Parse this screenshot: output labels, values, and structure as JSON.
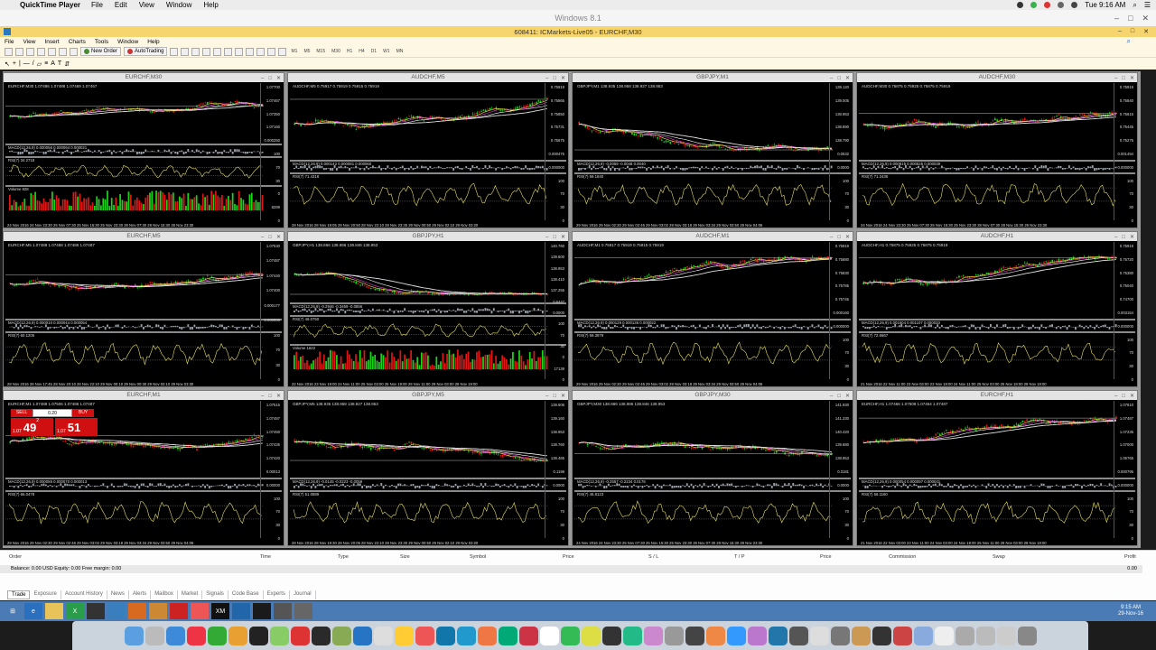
{
  "mac_menubar": {
    "app_name": "QuickTime Player",
    "menus": [
      "File",
      "Edit",
      "View",
      "Window",
      "Help"
    ],
    "clock": "Tue 9:16 AM"
  },
  "vm_title": "Windows 8.1",
  "mt4": {
    "title": "608411: ICMarkets-Live05 - EURCHF,M30",
    "menus": [
      "File",
      "View",
      "Insert",
      "Charts",
      "Tools",
      "Window",
      "Help"
    ],
    "new_order": "New Order",
    "autotrading": "AutoTrading",
    "timeframes": [
      "M1",
      "M5",
      "M15",
      "M30",
      "H1",
      "H4",
      "D1",
      "W1",
      "MN"
    ]
  },
  "charts": [
    {
      "title": "EURCHF,M30",
      "header": "EURCHF,M30 1.07486 1.07488 1.07469 1.07467",
      "macd": "MACD(12,26,9) 0.000056 0.000094 0.000021",
      "rsi": "RSI(7) 34.2718",
      "volume": "Volume 828",
      "xlabels": "24 Nov 2016   24 Nov 23:30   25 Nov 07:30   25 Nov 15:30   25 Nov 23:30   28 Nov 07:30   28 Nov 15:30   28 Nov 23:30",
      "scale": [
        "1.07700",
        "1.07467",
        "1.07350",
        "1.07160",
        "0.000250",
        "100",
        "70",
        "30",
        "0",
        "8289",
        "0"
      ]
    },
    {
      "title": "AUDCHF,M5",
      "header": "AUDCHF,M5 0.75917 0.75919 0.75915 0.75919",
      "macd": "MACD(12,26,9) 0.000142 0.000081 0.000060",
      "rsi": "RSI(7) 71.4318",
      "volume": "",
      "xlabels": "28 Nov 2016   28 Nov 19:05   28 Nov 20:50   28 Nov 22:10   28 Nov 23:35   29 Nov 00:50   29 Nov 02:10   29 Nov 03:20",
      "scale": [
        "0.75919",
        "0.75865",
        "0.75850",
        "0.75731",
        "0.75675",
        "0.000475",
        "0.000000",
        "100",
        "70",
        "30",
        "0"
      ]
    },
    {
      "title": "GBPJPY,M1",
      "header": "GBPJPY,M1 138.935 138.958 138.927 138.953",
      "macd": "MACD(12,26,9) -0.0059 -0.0048 0.0040",
      "rsi": "RSI(7) 59.1840",
      "volume": "",
      "xlabels": "29 Nov 2016   29 Nov 02:30   29 Nov 02:46   29 Nov 03:02   29 Nov 03:18   29 Nov 03:34   29 Nov 03:50   29 Nov 04:06",
      "scale": [
        "139.120",
        "139.005",
        "138.953",
        "138.890",
        "138.790",
        "0.0532",
        "0.0000",
        "100",
        "70",
        "30",
        "0"
      ]
    },
    {
      "title": "AUDCHF,M30",
      "header": "AUDCHF,M30 0.75875 0.75925 0.75875 0.75919",
      "macd": "MACD(12,26,9) 0.000915 0.000525 0.000039",
      "rsi": "RSI(7) 71.2436",
      "volume": "",
      "xlabels": "24 Nov 2016   24 Nov 23:30   25 Nov 07:30   25 Nov 15:30   25 Nov 23:30   28 Nov 07:30   28 Nov 15:30   28 Nov 23:30",
      "scale": [
        "0.75919",
        "0.75840",
        "0.75615",
        "0.75445",
        "0.75275",
        "0.001494",
        "0.000000",
        "100",
        "70",
        "30",
        "0"
      ]
    },
    {
      "title": "EURCHF,M5",
      "header": "EURCHF,M5 1.07488 1.07488 1.07486 1.07487",
      "macd": "MACD(12,26,9) 0.000010 0.000044 0.000054",
      "rsi": "RSI(7) 60.1206",
      "volume": "",
      "xlabels": "28 Nov 2016   28 Nov 17:45   28 Nov 20:10   28 Nov 22:10   29 Nov 00:10   29 Nov 00:30   29 Nov 02:10   29 Nov 03:30",
      "scale": [
        "1.07530",
        "1.07487",
        "1.07440",
        "1.07400",
        "0.000177",
        "0.000000",
        "100",
        "70",
        "30",
        "0"
      ]
    },
    {
      "title": "GBPJPY,H1",
      "header": "GBPJPY,H1 138.866 138.986 138.846 138.953",
      "macd": "MACD(12,26,9) -0.2946 -0.3459 -0.0856",
      "rsi": "RSI(7) 46.0750",
      "volume": "Volume 1622",
      "xlabels": "22 Nov 2016   23 Nov 19:00   24 Nov 11:00   25 Nov 03:00   25 Nov 19:00   28 Nov 11:00   29 Nov 03:00   28 Nov 19:00",
      "scale": [
        "140.760",
        "139.600",
        "138.953",
        "138.410",
        "137.255",
        "0.6447",
        "0.0000",
        "100",
        "70",
        "30",
        "0",
        "17139",
        "0"
      ]
    },
    {
      "title": "AUDCHF,M1",
      "header": "AUDCHF,M1 0.75917 0.75919 0.75915 0.75919",
      "macd": "MACD(12,26,9) 0.000129 0.000136 0.000022",
      "rsi": "RSI(7) 69.3879",
      "volume": "",
      "xlabels": "29 Nov 2016   29 Nov 02:30   29 Nov 02:46   29 Nov 03:02   29 Nov 03:18   29 Nov 03:34   29 Nov 03:50   29 Nov 04:06",
      "scale": [
        "0.75919",
        "0.75880",
        "0.75830",
        "0.75785",
        "0.75745",
        "0.000160",
        "0.000000",
        "100",
        "70",
        "30",
        "0"
      ]
    },
    {
      "title": "AUDCHF,H1",
      "header": "AUDCHF,H1 0.75875 0.75925 0.75875 0.75919",
      "macd": "MACD(12,26,9) 0.001604 0.001107 0.000033",
      "rsi": "RSI(7) 72.6667",
      "volume": "",
      "xlabels": "21 Nov 2016   22 Nov 11:00   23 Nov 03:00   23 Nov 19:00   24 Nov 11:00   25 Nov 03:00   25 Nov 19:00   28 Nov 19:00",
      "scale": [
        "0.75919",
        "0.75720",
        "0.75380",
        "0.75040",
        "0.74700",
        "0.003154",
        "0.000000",
        "100",
        "70",
        "30",
        "0"
      ]
    },
    {
      "title": "EURCHF,M1",
      "header": "EURCHF,M1 1.07488 1.07506 1.07486 1.07487",
      "macd": "MACD(12,26,9) 0.000085 0.000070 0.000013",
      "rsi": "RSI(7) 66.0478",
      "volume": "",
      "xlabels": "29 Nov 2016   29 Nov 02:30   29 Nov 02:46   29 Nov 03:02   29 Nov 03:18   29 Nov 03:34   29 Nov 03:50   29 Nov 04:06",
      "scale": [
        "1.07515",
        "1.07487",
        "1.07450",
        "1.07435",
        "1.07420",
        "0.00013",
        "0.00000",
        "100",
        "70",
        "30",
        "0"
      ]
    },
    {
      "title": "GBPJPY,M5",
      "header": "GBPJPY,M5 138.935 138.958 138.927 138.953",
      "macd": "MACD(12,26,9) -0.0145 -0.0223 -0.0058",
      "rsi": "RSI(7) 51.0889",
      "volume": "",
      "xlabels": "28 Nov 2016   28 Nov 19:30   28 Nov 20:05   28 Nov 22:10   28 Nov 23:30   29 Nov 00:50   29 Nov 02:10   29 Nov 03:20",
      "scale": [
        "139.606",
        "139.160",
        "138.953",
        "138.760",
        "138.465",
        "0.1198",
        "0.0000",
        "100",
        "70",
        "30",
        "0"
      ]
    },
    {
      "title": "GBPJPY,M30",
      "header": "GBPJPY,M30 138.886 138.986 138.846 138.953",
      "macd": "MACD(12,26,9) -0.2557 -0.2234 0.0176",
      "rsi": "RSI(7) 46.8123",
      "volume": "",
      "xlabels": "24 Nov 2016   24 Nov 23:30   25 Nov 07:30   25 Nov 15:30   25 Nov 23:30   28 Nov 07:30   28 Nov 15:30   28 Nov 23:30",
      "scale": [
        "141.930",
        "141.230",
        "140.420",
        "139.680",
        "138.953",
        "0.3181",
        "0.0000",
        "100",
        "70",
        "30",
        "0"
      ]
    },
    {
      "title": "EURCHF,H1",
      "header": "EURCHF,H1 1.07466 1.07508 1.07464 1.07487",
      "macd": "MACD(12,26,9) 0.000054 0.000097 0.000041",
      "rsi": "RSI(7) 56.1160",
      "volume": "",
      "xlabels": "21 Nov 2016   22 Nov 03:00   23 Nov 11:00   24 Nov 03:00   24 Nov 19:00   25 Nov 11:00   28 Nov 03:00   28 Nov 19:00",
      "scale": [
        "1.07810",
        "1.07487",
        "1.07235",
        "1.07000",
        "1.06765",
        "0.000795",
        "0.000000",
        "100",
        "70",
        "30",
        "0"
      ]
    }
  ],
  "oneclick": {
    "sell": "SELL",
    "buy": "BUY",
    "lot": "0.20",
    "sell_small": "1.07",
    "sell_big": "49",
    "sell_sup": "2",
    "buy_small": "1.07",
    "buy_big": "51"
  },
  "terminal": {
    "columns": [
      "Order",
      "Time",
      "Type",
      "Size",
      "Symbol",
      "Price",
      "S / L",
      "T / P",
      "Price",
      "Commission",
      "Swap",
      "Profit"
    ],
    "balance": "Balance: 0.00 USD  Equity: 0.00  Free margin: 0.00",
    "balance_value": "0.00",
    "tabs": [
      "Trade",
      "Exposure",
      "Account History",
      "News",
      "Alerts",
      "Mailbox",
      "Market",
      "Signals",
      "Code Base",
      "Experts",
      "Journal"
    ],
    "active_tab": "Trade",
    "side_label": "Terminal"
  },
  "taskbar": {
    "time": "9:15 AM",
    "date": "29-Nov-16"
  }
}
